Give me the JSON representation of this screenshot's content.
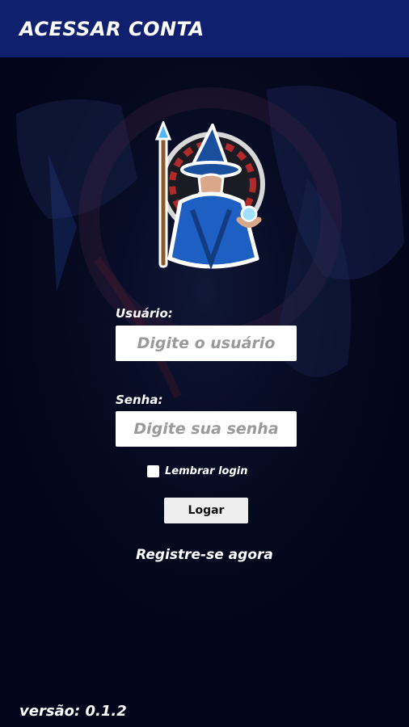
{
  "header": {
    "title": "ACESSAR CONTA"
  },
  "form": {
    "username_label": "Usuário:",
    "username_placeholder": "Digite o usuário",
    "password_label": "Senha:",
    "password_placeholder": "Digite sua senha",
    "remember_label": "Lembrar login",
    "remember_checked": false,
    "login_button": "Logar"
  },
  "links": {
    "register": "Registre-se agora"
  },
  "footer": {
    "version": "versão: 0.1.2"
  },
  "colors": {
    "header": "#101f6e",
    "background": "#03061a",
    "accent": "#1d5fc2"
  },
  "icons": {
    "logo": "wizard-roulette-logo"
  }
}
